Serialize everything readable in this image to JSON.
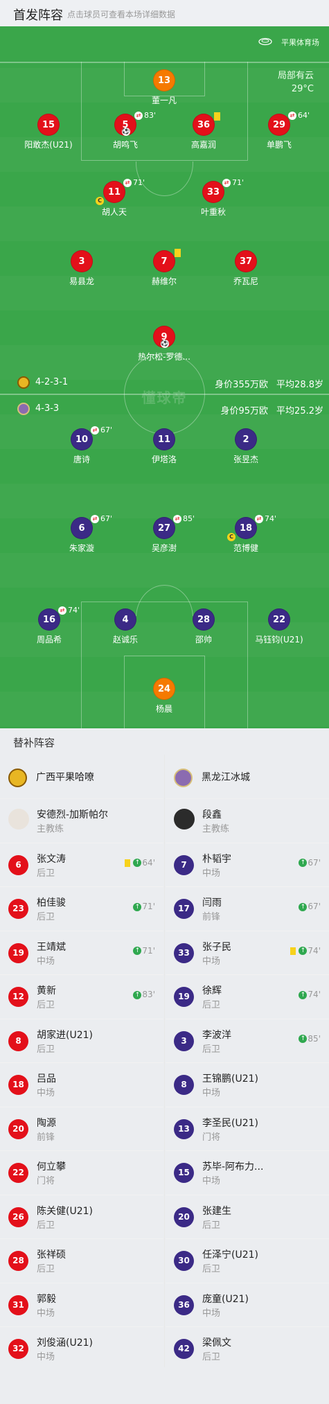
{
  "header": {
    "title": "首发阵容",
    "subtitle": "点击球员可查看本场详细数据"
  },
  "venue": {
    "name": "平果体育场",
    "weather": "局部有云",
    "temp": "29°C"
  },
  "home": {
    "formation": "4-2-3-1",
    "value": "身价355万欧",
    "avg_age": "平均28.8岁",
    "players": [
      {
        "num": "13",
        "name": "董一凡",
        "color": "org"
      },
      {
        "num": "15",
        "name": "阳敢杰(U21)",
        "color": "red"
      },
      {
        "num": "5",
        "name": "胡鸣飞",
        "color": "red",
        "sub": "83'",
        "goal": true
      },
      {
        "num": "36",
        "name": "高嘉润",
        "color": "red",
        "yellow": true
      },
      {
        "num": "29",
        "name": "单鹏飞",
        "color": "red",
        "sub": "64'"
      },
      {
        "num": "11",
        "name": "胡人天",
        "color": "red",
        "sub": "71'",
        "captain": true
      },
      {
        "num": "33",
        "name": "叶重秋",
        "color": "red",
        "sub": "71'"
      },
      {
        "num": "3",
        "name": "易县龙",
        "color": "red"
      },
      {
        "num": "7",
        "name": "赫维尔",
        "color": "red",
        "yellow": true
      },
      {
        "num": "37",
        "name": "乔瓦尼",
        "color": "red"
      },
      {
        "num": "9",
        "name": "热尔松-罗德...",
        "color": "red",
        "goal": true
      }
    ]
  },
  "away": {
    "formation": "4-3-3",
    "value": "身价95万欧",
    "avg_age": "平均25.2岁",
    "players": [
      {
        "num": "10",
        "name": "唐诗",
        "color": "pur",
        "sub": "67'"
      },
      {
        "num": "11",
        "name": "伊塔洛",
        "color": "pur"
      },
      {
        "num": "2",
        "name": "张昱杰",
        "color": "pur"
      },
      {
        "num": "6",
        "name": "朱家漩",
        "color": "pur",
        "sub": "67'"
      },
      {
        "num": "27",
        "name": "吴彦澍",
        "color": "pur",
        "sub": "85'"
      },
      {
        "num": "18",
        "name": "范博健",
        "color": "pur",
        "sub": "74'",
        "captain": true
      },
      {
        "num": "16",
        "name": "周品希",
        "color": "pur",
        "sub": "74'"
      },
      {
        "num": "4",
        "name": "赵诚乐",
        "color": "pur"
      },
      {
        "num": "28",
        "name": "邵帅",
        "color": "pur"
      },
      {
        "num": "22",
        "name": "马钰钧(U21)",
        "color": "pur"
      },
      {
        "num": "24",
        "name": "杨晨",
        "color": "org"
      }
    ]
  },
  "watermark": "懂球帝",
  "subs_title": "替补阵容",
  "left_team": {
    "name": "广西平果哈嘹",
    "coach": "安德烈-加斯帕尔",
    "coach_role": "主教练",
    "subs": [
      {
        "num": "6",
        "name": "张文涛",
        "pos": "后卫",
        "in": "64'",
        "yellow": true
      },
      {
        "num": "23",
        "name": "柏佳骏",
        "pos": "后卫",
        "in": "71'"
      },
      {
        "num": "19",
        "name": "王靖斌",
        "pos": "中场",
        "in": "71'"
      },
      {
        "num": "12",
        "name": "黄新",
        "pos": "后卫",
        "in": "83'"
      },
      {
        "num": "8",
        "name": "胡家进(U21)",
        "pos": "后卫",
        "in": ""
      },
      {
        "num": "18",
        "name": "吕品",
        "pos": "中场",
        "in": ""
      },
      {
        "num": "20",
        "name": "陶源",
        "pos": "前锋",
        "in": ""
      },
      {
        "num": "22",
        "name": "何立攀",
        "pos": "门将",
        "in": ""
      },
      {
        "num": "26",
        "name": "陈关健(U21)",
        "pos": "后卫",
        "in": ""
      },
      {
        "num": "28",
        "name": "张祥硕",
        "pos": "后卫",
        "in": ""
      },
      {
        "num": "31",
        "name": "郭毅",
        "pos": "中场",
        "in": ""
      },
      {
        "num": "32",
        "name": "刘俊涵(U21)",
        "pos": "中场",
        "in": ""
      }
    ]
  },
  "right_team": {
    "name": "黑龙江冰城",
    "coach": "段鑫",
    "coach_role": "主教练",
    "subs": [
      {
        "num": "7",
        "name": "朴韬宇",
        "pos": "中场",
        "in": "67'"
      },
      {
        "num": "17",
        "name": "闫雨",
        "pos": "前锋",
        "in": "67'"
      },
      {
        "num": "33",
        "name": "张子民",
        "pos": "中场",
        "in": "74'",
        "yellow": true
      },
      {
        "num": "19",
        "name": "徐辉",
        "pos": "后卫",
        "in": "74'"
      },
      {
        "num": "3",
        "name": "李波洋",
        "pos": "后卫",
        "in": "85'"
      },
      {
        "num": "8",
        "name": "王锦鹏(U21)",
        "pos": "中场",
        "in": ""
      },
      {
        "num": "13",
        "name": "李圣民(U21)",
        "pos": "门将",
        "in": ""
      },
      {
        "num": "15",
        "name": "苏毕-阿布力...",
        "pos": "中场",
        "in": ""
      },
      {
        "num": "20",
        "name": "张建生",
        "pos": "后卫",
        "in": ""
      },
      {
        "num": "30",
        "name": "任泽宁(U21)",
        "pos": "后卫",
        "in": ""
      },
      {
        "num": "36",
        "name": "庞童(U21)",
        "pos": "中场",
        "in": ""
      },
      {
        "num": "42",
        "name": "梁佩文",
        "pos": "后卫",
        "in": ""
      }
    ]
  }
}
